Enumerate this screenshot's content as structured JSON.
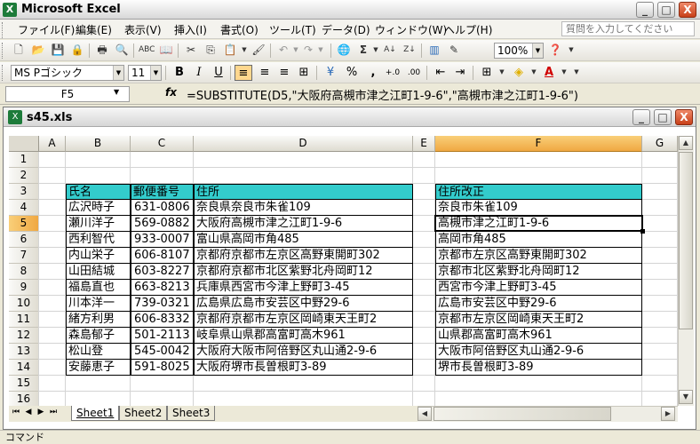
{
  "app": {
    "title": "Microsoft Excel",
    "minimize": "_",
    "restore": "□",
    "close": "X"
  },
  "menu": {
    "items": [
      "ファイル(F)",
      "編集(E)",
      "表示(V)",
      "挿入(I)",
      "書式(O)",
      "ツール(T)",
      "データ(D)",
      "ウィンドウ(W)",
      "ヘルプ(H)"
    ],
    "help_placeholder": "質問を入力してください"
  },
  "toolbar": {
    "zoom": "100%",
    "font": "MS Pゴシック",
    "font_size": "11",
    "bold": "B",
    "italic": "I",
    "underline": "U",
    "percent": "%",
    "comma": ",",
    "sigma": "Σ"
  },
  "formula_bar": {
    "name_box": "F5",
    "fx": "fx",
    "formula": "=SUBSTITUTE(D5,\"大阪府高槻市津之江町1-9-6\",\"高槻市津之江町1-9-6\")"
  },
  "workbook": {
    "title": "s45.xls",
    "minimize": "_",
    "restore": "□",
    "close": "X"
  },
  "grid": {
    "columns": [
      "A",
      "B",
      "C",
      "D",
      "E",
      "F",
      "G"
    ],
    "rows": [
      "1",
      "2",
      "3",
      "4",
      "5",
      "6",
      "7",
      "8",
      "9",
      "10",
      "11",
      "12",
      "13",
      "14",
      "15",
      "16"
    ],
    "headers": {
      "name": "氏名",
      "zip": "郵便番号",
      "address": "住所",
      "revised": "住所改正"
    },
    "records": [
      {
        "name": "広沢時子",
        "zip": "631-0806",
        "address": "奈良県奈良市朱雀109",
        "revised": "奈良市朱雀109"
      },
      {
        "name": "瀬川洋子",
        "zip": "569-0882",
        "address": "大阪府高槻市津之江町1-9-6",
        "revised": "高槻市津之江町1-9-6"
      },
      {
        "name": "西利智代",
        "zip": "933-0007",
        "address": "富山県高岡市角485",
        "revised": "高岡市角485"
      },
      {
        "name": "内山栄子",
        "zip": "606-8107",
        "address": "京都府京都市左京区高野東開町302",
        "revised": "京都市左京区高野東開町302"
      },
      {
        "name": "山田結城",
        "zip": "603-8227",
        "address": "京都府京都市北区紫野北舟岡町12",
        "revised": "京都市北区紫野北舟岡町12"
      },
      {
        "name": "福島直也",
        "zip": "663-8213",
        "address": "兵庫県西宮市今津上野町3-45",
        "revised": "西宮市今津上野町3-45"
      },
      {
        "name": "川本洋一",
        "zip": "739-0321",
        "address": "広島県広島市安芸区中野29-6",
        "revised": "広島市安芸区中野29-6"
      },
      {
        "name": "緒方利男",
        "zip": "606-8332",
        "address": "京都府京都市左京区岡崎東天王町2",
        "revised": "京都市左京区岡崎東天王町2"
      },
      {
        "name": "森島郁子",
        "zip": "501-2113",
        "address": "岐阜県山県郡高富町高木961",
        "revised": "山県郡高富町高木961"
      },
      {
        "name": "松山登",
        "zip": "545-0042",
        "address": "大阪府大阪市阿倍野区丸山通2-9-6",
        "revised": "大阪市阿倍野区丸山通2-9-6"
      },
      {
        "name": "安藤恵子",
        "zip": "591-8025",
        "address": "大阪府堺市長曽根町3-89",
        "revised": "堺市長曽根町3-89"
      }
    ]
  },
  "sheets": [
    "Sheet1",
    "Sheet2",
    "Sheet3"
  ],
  "status": "コマンド"
}
